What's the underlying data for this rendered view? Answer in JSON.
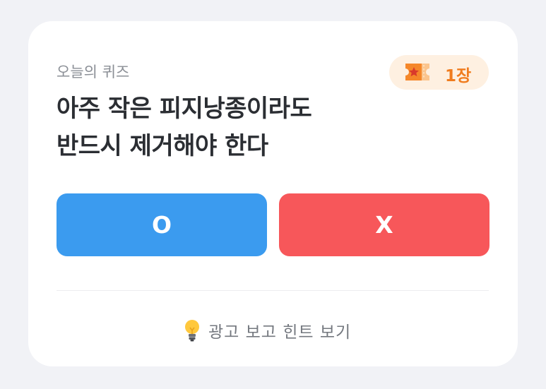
{
  "quiz": {
    "label": "오늘의 퀴즈",
    "question_line1": "아주 작은 피지낭종이라도",
    "question_line2": "반드시 제거해야 한다",
    "ticket": {
      "icon": "ticket-star-icon",
      "count": "1장"
    },
    "answers": {
      "o_label": "O",
      "x_label": "X"
    },
    "hint": {
      "icon": "lightbulb-icon",
      "label": "광고 보고 힌트 보기"
    }
  },
  "colors": {
    "background": "#F1F2F6",
    "card": "#FFFFFF",
    "o_button": "#3B9BEF",
    "x_button": "#F7575A",
    "ticket_accent": "#F07C1E",
    "ticket_badge_bg": "#FEF0E1"
  }
}
